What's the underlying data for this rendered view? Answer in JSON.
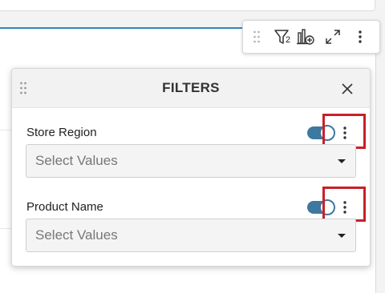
{
  "panel": {
    "title": "FILTERS",
    "filters": [
      {
        "label": "Store Region",
        "placeholder": "Select Values",
        "enabled": true
      },
      {
        "label": "Product Name",
        "placeholder": "Select Values",
        "enabled": true
      }
    ]
  },
  "toolbar": {
    "filter_count": "2",
    "icons": [
      "drag-handle-icon",
      "filter-icon",
      "add-chart-icon",
      "expand-icon",
      "more-options-icon"
    ]
  },
  "colors": {
    "accent": "#3d78a0",
    "highlight": "#c8202a",
    "card_border": "#2e86c1"
  }
}
